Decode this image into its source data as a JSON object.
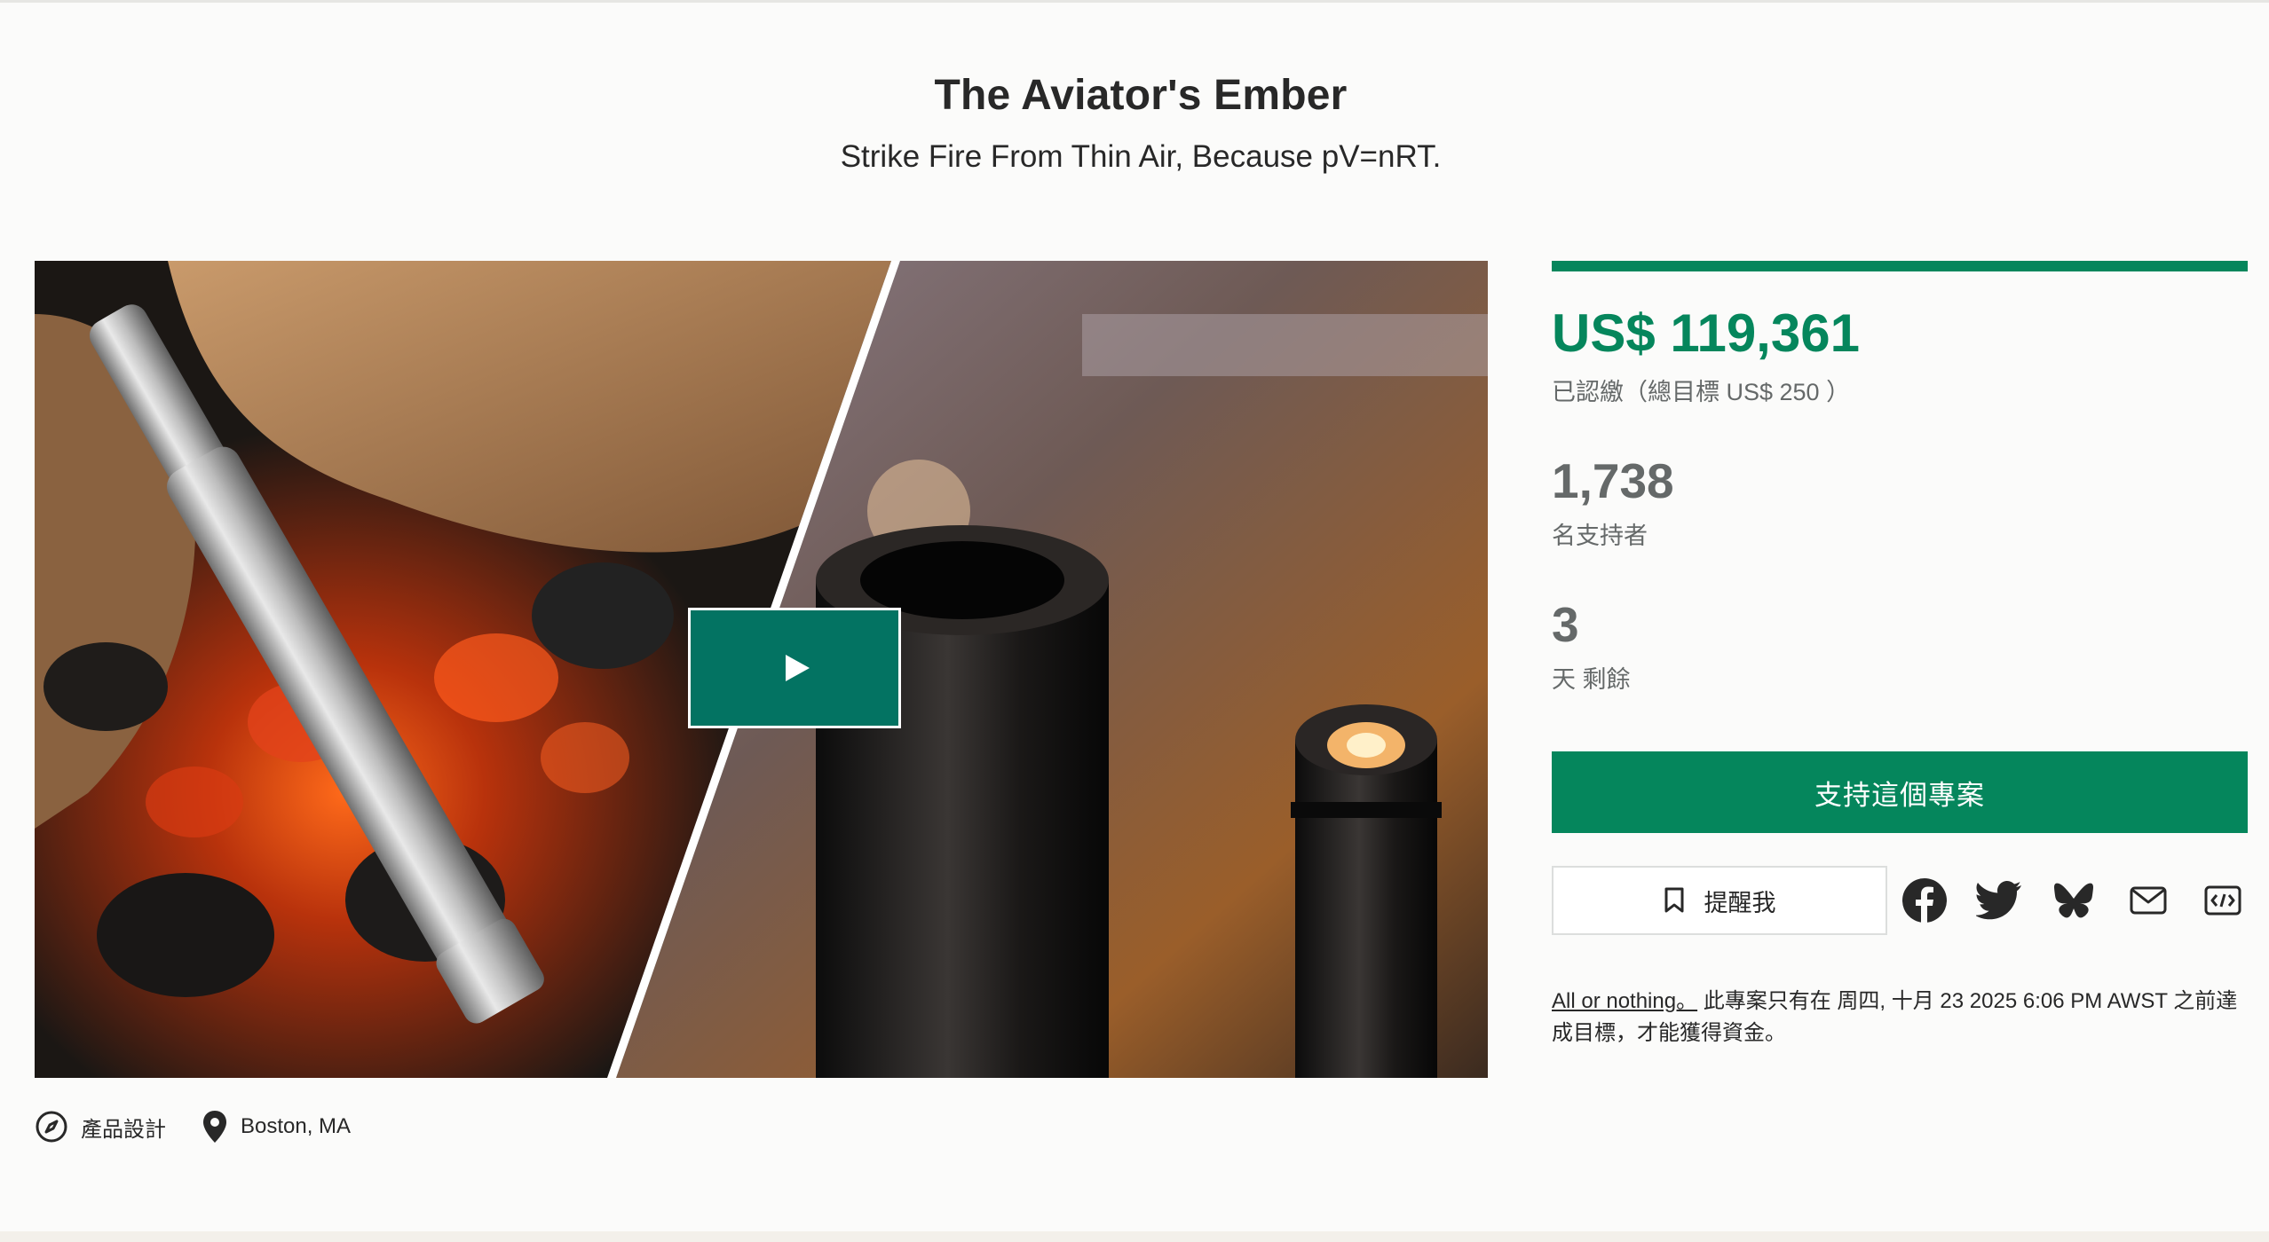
{
  "project": {
    "title": "The Aviator's Ember",
    "subtitle": "Strike Fire From Thin Air, Because pV=nRT."
  },
  "meta": {
    "category": "產品設計",
    "category_icon": "compass-icon",
    "location": "Boston, MA",
    "location_icon": "map-pin-icon"
  },
  "stats": {
    "pledged": "US$ 119,361",
    "pledged_caption": "已認繳（總目標 US$ 250 ）",
    "progress_fraction": 1.0,
    "backers": "1,738",
    "backers_caption": "名支持者",
    "days_left": "3",
    "days_left_caption": "天 剩餘"
  },
  "actions": {
    "back_label": "支持這個專案",
    "remind_label": "提醒我",
    "share": [
      "facebook-icon",
      "twitter-icon",
      "bluesky-icon",
      "email-icon",
      "embed-icon"
    ]
  },
  "notice": {
    "aon_link": "All or nothing。",
    "text": " 此專案只有在 周四, 十月 23 2025 6:06 PM AWST 之前達成目標，才能獲得資金。"
  },
  "colors": {
    "accent": "#05865c",
    "play_button": "#037362",
    "muted_text": "#656969"
  }
}
